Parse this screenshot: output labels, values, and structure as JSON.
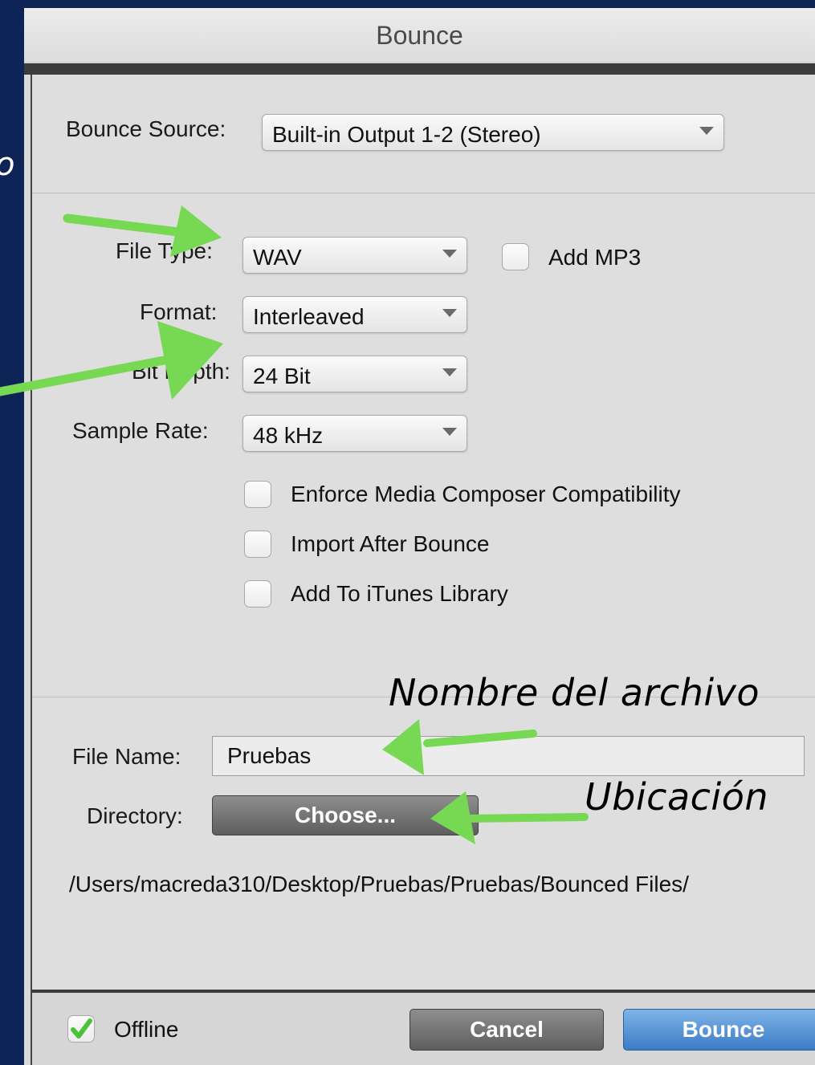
{
  "window": {
    "title": "Bounce"
  },
  "edge_text": "o",
  "bounce_source": {
    "label": "Bounce Source:",
    "value": "Built-in Output 1-2 (Stereo)"
  },
  "file_type": {
    "label": "File Type:",
    "value": "WAV"
  },
  "add_mp3": {
    "label": "Add MP3",
    "checked": false
  },
  "format": {
    "label": "Format:",
    "value": "Interleaved"
  },
  "bit_depth": {
    "label": "Bit Depth:",
    "value": "24 Bit"
  },
  "sample_rate": {
    "label": "Sample Rate:",
    "value": "48 kHz"
  },
  "options": [
    {
      "label": "Enforce Media Composer Compatibility",
      "checked": false
    },
    {
      "label": "Import After Bounce",
      "checked": false
    },
    {
      "label": "Add To iTunes Library",
      "checked": false
    }
  ],
  "file_name": {
    "label": "File Name:",
    "value": "Pruebas"
  },
  "directory": {
    "label": "Directory:",
    "button_label": "Choose...",
    "path": "/Users/macreda310/Desktop/Pruebas/Pruebas/Bounced Files/"
  },
  "footer": {
    "offline_label": "Offline",
    "offline_checked": true,
    "cancel_label": "Cancel",
    "bounce_label": "Bounce"
  },
  "annotations": {
    "file_name_note": "Nombre del archivo",
    "location_note": "Ubicación"
  },
  "colors": {
    "arrow": "#77d854",
    "background": "#0e2356",
    "bounce_button": "#3a7cc6",
    "check": "#4cc23a"
  }
}
